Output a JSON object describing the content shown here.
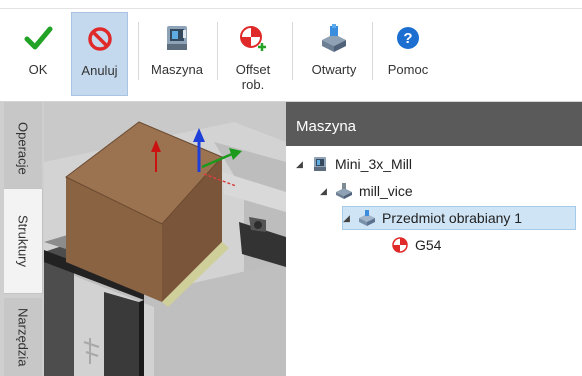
{
  "toolbar": {
    "ok_label": "OK",
    "cancel_label": "Anuluj",
    "machine_label": "Maszyna",
    "offset_label_line1": "Offset",
    "offset_label_line2": "rob.",
    "open_label": "Otwarty",
    "help_label": "Pomoc"
  },
  "side_tabs": {
    "operations": "Operacje",
    "structures": "Struktury",
    "tools": "Narzędzia"
  },
  "panel": {
    "title": "Maszyna",
    "tree": [
      {
        "label": "Mini_3x_Mill",
        "icon": "machine-icon"
      },
      {
        "label": "mill_vice",
        "icon": "vice-icon"
      },
      {
        "label": "Przedmiot obrabiany 1",
        "icon": "workpiece-icon",
        "selected": true
      },
      {
        "label": "G54",
        "icon": "work-offset-icon"
      }
    ]
  },
  "colors": {
    "accent_selected": "#c5d9ee",
    "tree_selected": "#cfe5f6",
    "panel_header": "#5a5a5a",
    "check_green": "#22a326",
    "cancel_red": "#e02a2a",
    "help_blue": "#1c6fd1",
    "stock_brown": "#9b7351"
  }
}
